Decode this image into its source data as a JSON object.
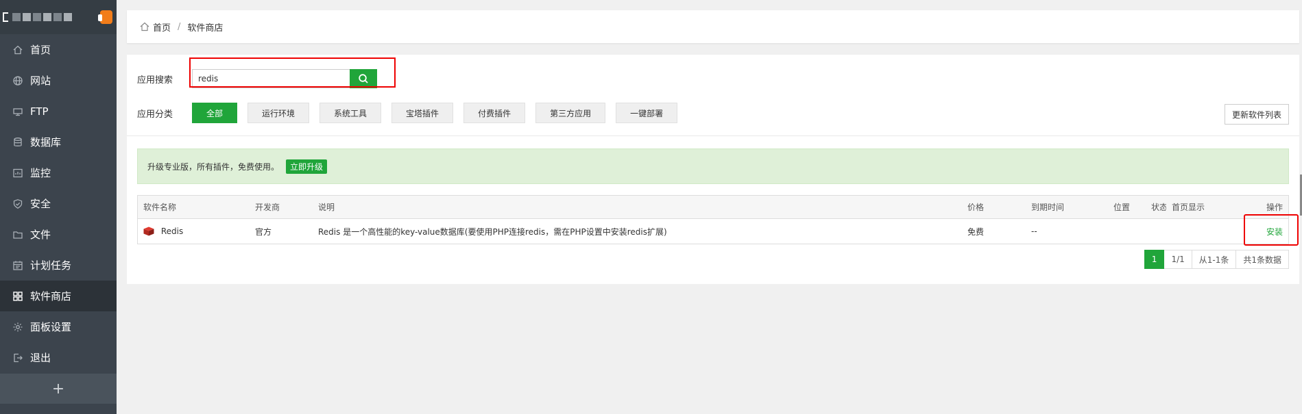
{
  "sidebar": {
    "items": [
      {
        "label": "首页",
        "icon": "home-icon"
      },
      {
        "label": "网站",
        "icon": "globe-icon"
      },
      {
        "label": "FTP",
        "icon": "ftp-icon"
      },
      {
        "label": "数据库",
        "icon": "database-icon"
      },
      {
        "label": "监控",
        "icon": "monitor-icon"
      },
      {
        "label": "安全",
        "icon": "shield-icon"
      },
      {
        "label": "文件",
        "icon": "folder-icon"
      },
      {
        "label": "计划任务",
        "icon": "calendar-icon"
      },
      {
        "label": "软件商店",
        "icon": "apps-icon"
      },
      {
        "label": "面板设置",
        "icon": "gear-icon"
      },
      {
        "label": "退出",
        "icon": "logout-icon"
      }
    ],
    "active": "软件商店",
    "add_label": "+"
  },
  "breadcrumb": {
    "home": "首页",
    "separator": "/",
    "current": "软件商店"
  },
  "search": {
    "label": "应用搜索",
    "value": "redis"
  },
  "categories": {
    "label": "应用分类",
    "items": [
      "全部",
      "运行环境",
      "系统工具",
      "宝塔插件",
      "付费插件",
      "第三方应用",
      "一键部署"
    ],
    "active": "全部"
  },
  "refresh_label": "更新软件列表",
  "notice": {
    "text": "升级专业版，所有插件，免费使用。",
    "button": "立即升级"
  },
  "table": {
    "headers": [
      "软件名称",
      "开发商",
      "说明",
      "价格",
      "到期时间",
      "位置",
      "状态",
      "首页显示",
      "操作"
    ],
    "rows": [
      {
        "name": "Redis",
        "vendor": "官方",
        "description": "Redis 是一个高性能的key-value数据库(要使用PHP连接redis，需在PHP设置中安装redis扩展)",
        "price": "免费",
        "expire": "--",
        "location": "",
        "status": "",
        "home_display": "",
        "action": "安装"
      }
    ]
  },
  "pagination": {
    "current": "1",
    "pages": "1/1",
    "range": "从1-1条",
    "total": "共1条数据"
  },
  "colors": {
    "accent": "#20a53a",
    "sidebar": "#3c444d",
    "highlight": "#e00000"
  }
}
